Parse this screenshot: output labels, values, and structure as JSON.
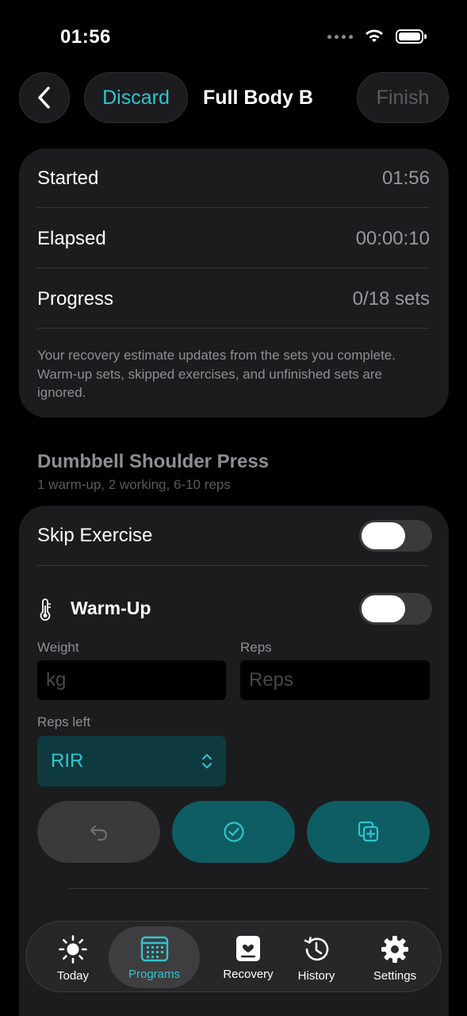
{
  "status_bar": {
    "time": "01:56"
  },
  "nav": {
    "discard": "Discard",
    "title": "Full Body B",
    "finish": "Finish"
  },
  "summary": {
    "rows": [
      {
        "label": "Started",
        "value": "01:56"
      },
      {
        "label": "Elapsed",
        "value": "00:00:10"
      },
      {
        "label": "Progress",
        "value": "0/18 sets"
      }
    ],
    "note": "Your recovery estimate updates from the sets you complete. Warm-up sets, skipped exercises, and unfinished sets are ignored."
  },
  "exercise": {
    "name": "Dumbbell Shoulder Press",
    "detail": "1 warm-up, 2 working, 6-10 reps",
    "skip_label": "Skip Exercise",
    "skip_on": false,
    "warmup_label": "Warm-Up",
    "warmup_on": false,
    "weight_label": "Weight",
    "weight_placeholder": "kg",
    "reps_label": "Reps",
    "reps_placeholder": "Reps",
    "reps_left_label": "Reps left",
    "reps_left_value": "RIR"
  },
  "tabs": [
    {
      "label": "Today",
      "icon": "sun-icon"
    },
    {
      "label": "Programs",
      "icon": "calendar-icon",
      "active": true
    },
    {
      "label": "Recovery",
      "icon": "clipboard-heart-icon"
    },
    {
      "label": "History",
      "icon": "history-icon"
    },
    {
      "label": "Settings",
      "icon": "gear-icon"
    }
  ],
  "colors": {
    "accent": "#2fc5cf",
    "card": "#1c1c1e",
    "background": "#000000"
  }
}
